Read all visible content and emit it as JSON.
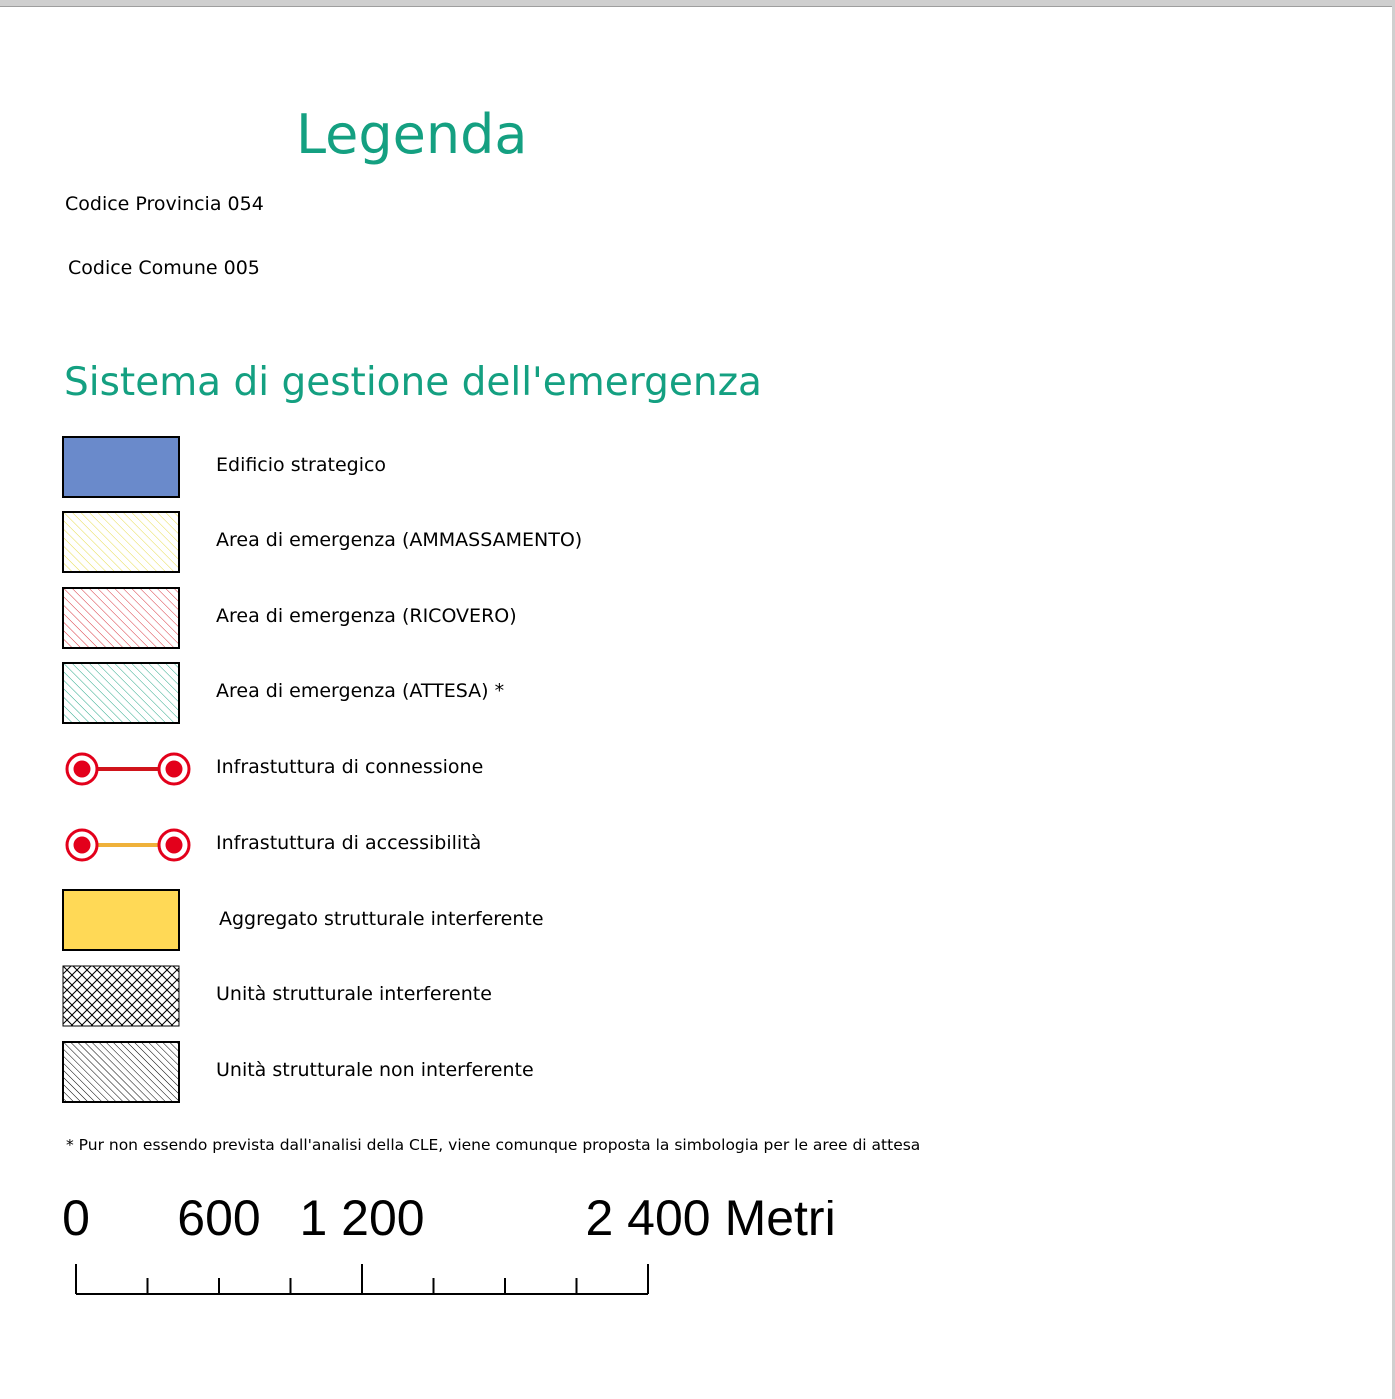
{
  "title": "Legenda",
  "codice_provincia": "Codice Provincia 054",
  "codice_comune": "Codice Comune 005",
  "section_title": "Sistema di gestione dell'emergenza",
  "legend": [
    {
      "label": "Edificio strategico",
      "symbol": "solid",
      "fill": "#6a8acb"
    },
    {
      "label": "Area di emergenza (AMMASSAMENTO)",
      "symbol": "hatch",
      "hatch_color": "#e7dc4a"
    },
    {
      "label": "Area di emergenza (RICOVERO)",
      "symbol": "hatch",
      "hatch_color": "#d9333c"
    },
    {
      "label": "Area di emergenza (ATTESA) *",
      "symbol": "hatch",
      "hatch_color": "#29a889"
    },
    {
      "label": "Infrastuttura di connessione",
      "symbol": "line-node",
      "line_color": "#d0141b"
    },
    {
      "label": "Infrastuttura di accessibilità",
      "symbol": "line-node",
      "line_color": "#efb13a"
    },
    {
      "label": "Aggregato strutturale interferente",
      "symbol": "solid",
      "fill": "#ffd956"
    },
    {
      "label": "Unità strutturale interferente",
      "symbol": "crosshatch",
      "hatch_color": "#000000"
    },
    {
      "label": "Unità strutturale non interferente",
      "symbol": "hatch-dense",
      "hatch_color": "#000000"
    }
  ],
  "footnote": "* Pur non essendo prevista dall'analisi della CLE, viene comunque proposta la simbologia per le aree di attesa",
  "scale_bar": {
    "labels": [
      "0",
      "600",
      "1 200",
      "2 400"
    ],
    "values": [
      0,
      600,
      1200,
      2400
    ],
    "unit": "Metri",
    "max": 2400,
    "divisions": 8
  },
  "colors": {
    "accent": "#14a081",
    "node_red": "#e3001b"
  }
}
